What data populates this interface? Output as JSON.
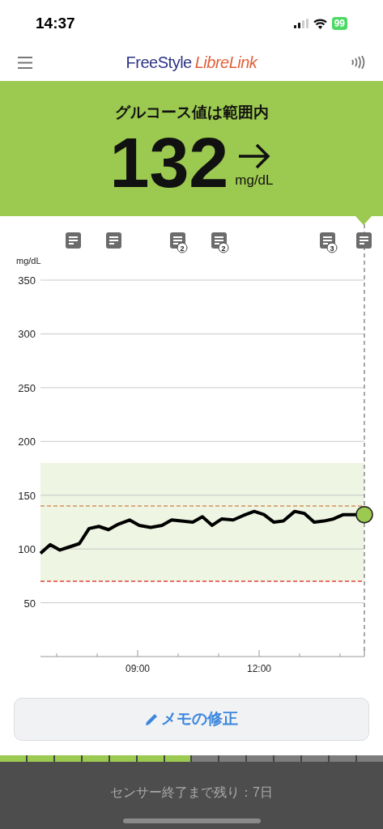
{
  "status_bar": {
    "time": "14:37",
    "battery": "99"
  },
  "header": {
    "brand_first": "FreeStyle",
    "brand_second": "LibreLink"
  },
  "reading": {
    "status": "グルコース値は範囲内",
    "value": "132",
    "unit": "mg/dL"
  },
  "chart": {
    "notes": [
      {
        "kind": "plain"
      },
      {
        "kind": "plain"
      },
      {
        "kind": "counted",
        "count": "2"
      },
      {
        "kind": "counted",
        "count": "2"
      },
      {
        "kind": "counted",
        "count": "3"
      },
      {
        "kind": "plain"
      }
    ],
    "chart_data": {
      "type": "line",
      "ylabel": "mg/dL",
      "xlim": [
        6.6,
        14.6
      ],
      "ylim": [
        0,
        350
      ],
      "grid": true,
      "yticks": [
        50,
        100,
        150,
        200,
        250,
        300,
        350
      ],
      "xticks": [
        {
          "value": 9,
          "label": "09:00"
        },
        {
          "value": 12,
          "label": "12:00"
        }
      ],
      "x": [
        6.6,
        6.84,
        7.08,
        7.32,
        7.56,
        7.8,
        8.04,
        8.28,
        8.52,
        8.8,
        9.04,
        9.32,
        9.6,
        9.84,
        10.08,
        10.36,
        10.6,
        10.84,
        11.08,
        11.36,
        11.6,
        11.88,
        12.12,
        12.36,
        12.6,
        12.88,
        13.12,
        13.36,
        13.6,
        13.84,
        14.08,
        14.4,
        14.6
      ],
      "series": [
        {
          "color": "#000000",
          "values": [
            96,
            104,
            99,
            102,
            105,
            119,
            121,
            118,
            123,
            127,
            122,
            120,
            122,
            127,
            126,
            125,
            130,
            122,
            128,
            127,
            131,
            135,
            132,
            125,
            126,
            135,
            133,
            125,
            126,
            128,
            132,
            132,
            132
          ]
        }
      ],
      "bands": [
        {
          "axis": "y",
          "from": 70,
          "to": 180,
          "color": "#eef5e2"
        }
      ],
      "ref_lines": [
        {
          "axis": "y",
          "value": 140,
          "color": "#d4915e"
        },
        {
          "axis": "y",
          "value": 70,
          "color": "#e0463c"
        }
      ]
    }
  },
  "edit_button": {
    "label": "メモの修正"
  },
  "sensor": {
    "segments": [
      {
        "filled": true
      },
      {
        "filled": true
      },
      {
        "filled": true
      },
      {
        "filled": true
      },
      {
        "filled": true
      },
      {
        "filled": true
      },
      {
        "filled": true
      },
      {
        "filled": false
      },
      {
        "filled": false
      },
      {
        "filled": false
      },
      {
        "filled": false
      },
      {
        "filled": false
      },
      {
        "filled": false
      },
      {
        "filled": false
      }
    ],
    "remaining": "センサー終了まで残り：7日"
  }
}
